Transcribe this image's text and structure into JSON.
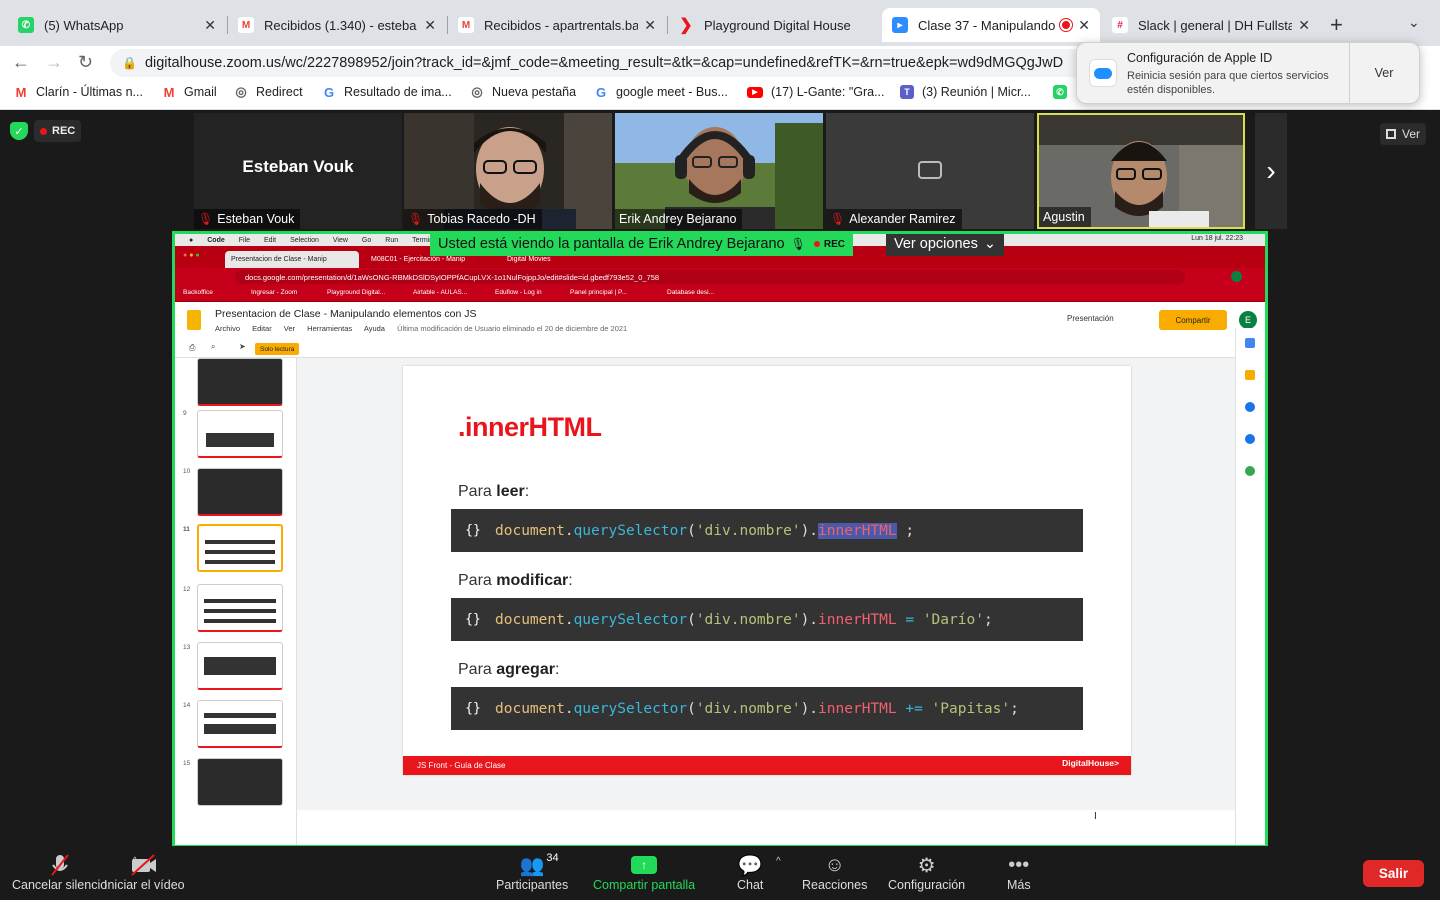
{
  "browser": {
    "tabs": [
      {
        "title": "(5) WhatsApp",
        "fav": "whatsapp-icon",
        "color": "#25d366"
      },
      {
        "title": "Recibidos (1.340) - esteba",
        "fav": "gmail-icon",
        "color": "#ea4335"
      },
      {
        "title": "Recibidos - apartrentals.ba",
        "fav": "gmail-icon",
        "color": "#ea4335"
      },
      {
        "title": "Playground Digital House",
        "fav": "dh-icon",
        "color": "#e8161c"
      },
      {
        "title": "Clase 37 - Manipulando",
        "fav": "zoom-icon",
        "color": "#2d8cff"
      },
      {
        "title": "Slack | general | DH Fullsta",
        "fav": "slack-icon",
        "color": "#e01e5a"
      }
    ],
    "url_host": "digitalhouse.zoom.us",
    "url_path": "/wc/2227898952/join?track_id=&jmf_code=&meeting_result=&tk=&cap=undefined&refTK=&rn=true&epk=wd9dMGQgJwD",
    "bookmarks": [
      {
        "label": "Clarín - Últimas n...",
        "color": "#ea4335",
        "glyph": "M"
      },
      {
        "label": "Gmail",
        "color": "#ea4335",
        "glyph": "M"
      },
      {
        "label": "Redirect",
        "color": "#5f6368",
        "glyph": "◎"
      },
      {
        "label": "Resultado de ima...",
        "color": "#4285f4",
        "glyph": "G"
      },
      {
        "label": "Nueva pestaña",
        "color": "#5f6368",
        "glyph": "◎"
      },
      {
        "label": "google meet - Bus...",
        "color": "#4285f4",
        "glyph": "G"
      },
      {
        "label": "(17) L-Gante: \"Gra...",
        "color": "#ff0000",
        "glyph": "▶"
      },
      {
        "label": "(3) Reunión | Micr...",
        "color": "#5b5fc7",
        "glyph": "T"
      }
    ]
  },
  "notification": {
    "title": "Configuración de Apple ID",
    "body": "Reinicia sesión para que ciertos servicios estén disponibles.",
    "button": "Ver"
  },
  "zoom": {
    "rec_label": "REC",
    "view_label": "Ver",
    "participants": [
      {
        "name": "Esteban Vouk",
        "muted": true,
        "video": false
      },
      {
        "name": "Tobias Racedo -DH",
        "muted": true,
        "video": true
      },
      {
        "name": "Erik Andrey Bejarano",
        "muted": false,
        "video": true
      },
      {
        "name": "Alexander Ramirez",
        "muted": true,
        "video": false
      },
      {
        "name": "Agustin",
        "muted": false,
        "video": true
      }
    ],
    "viewing_banner": "Usted está viendo la pantalla de Erik Andrey Bejarano",
    "banner_rec": "REC",
    "view_options": "Ver opciones",
    "toolbar": {
      "mute": "Cancelar silencio",
      "video": "Iniciar el vídeo",
      "participants": "Participantes",
      "participants_count": "34",
      "share": "Compartir pantalla",
      "chat": "Chat",
      "reactions": "Reacciones",
      "settings": "Configuración",
      "more": "Más",
      "leave": "Salir"
    }
  },
  "shared": {
    "mac_menu": [
      "Code",
      "File",
      "Edit",
      "Selection",
      "View",
      "Go",
      "Run",
      "Terminal"
    ],
    "mac_clock": "Lun 18 jul. 22:23",
    "inner_tabs": [
      "Presentacion de Clase - Manip",
      "M08C01 - Ejercitación - Manip",
      "Digital Movies"
    ],
    "inner_url": "docs.google.com/presentation/d/1aWsONG-RBMkDSlDSyIOPPfACupLVX-1o1NulFojppJo/edit#slide=id.gbedf793e52_0_758",
    "inner_bookmarks": [
      "Backoffice",
      "Ingresar - Zoom",
      "Playground Digital...",
      "Airtable - AULAS...",
      "Eduflow - Log in",
      "Panel principal | P...",
      "Database desi..."
    ],
    "doc_title": "Presentacion de Clase - Manipulando elementos con JS",
    "doc_menu": [
      "Archivo",
      "Editar",
      "Ver",
      "Herramientas",
      "Ayuda"
    ],
    "doc_modified": "Última modificación de Usuario eliminado el 20 de diciembre de 2021",
    "presentation_btn": "Presentación",
    "share_btn": "Compartir",
    "avatar": "E",
    "readonly": "Solo lectura",
    "thumb_numbers": [
      "9",
      "10",
      "11",
      "12",
      "13",
      "14",
      "15"
    ],
    "slide": {
      "heading": ".innerHTML",
      "read_prefix": "Para ",
      "read_bold": "leer",
      "modify_prefix": "Para ",
      "modify_bold": "modificar",
      "add_prefix": "Para ",
      "add_bold": "agregar",
      "colon": ":",
      "brace": "{}",
      "code_doc": "document",
      "code_dot": ".",
      "code_qs": "querySelector",
      "code_open": "(",
      "code_arg": "'div.nombre'",
      "code_close": ").",
      "code_prop": "innerHTML",
      "code1_tail": " ;",
      "code2_op": " = ",
      "code2_val": "'Darío'",
      "code3_op": " += ",
      "code3_val": "'Papitas'",
      "code_semi": ";",
      "footer_left": "JS Front - Guía de Clase",
      "footer_right": "DigitalHouse>"
    }
  }
}
